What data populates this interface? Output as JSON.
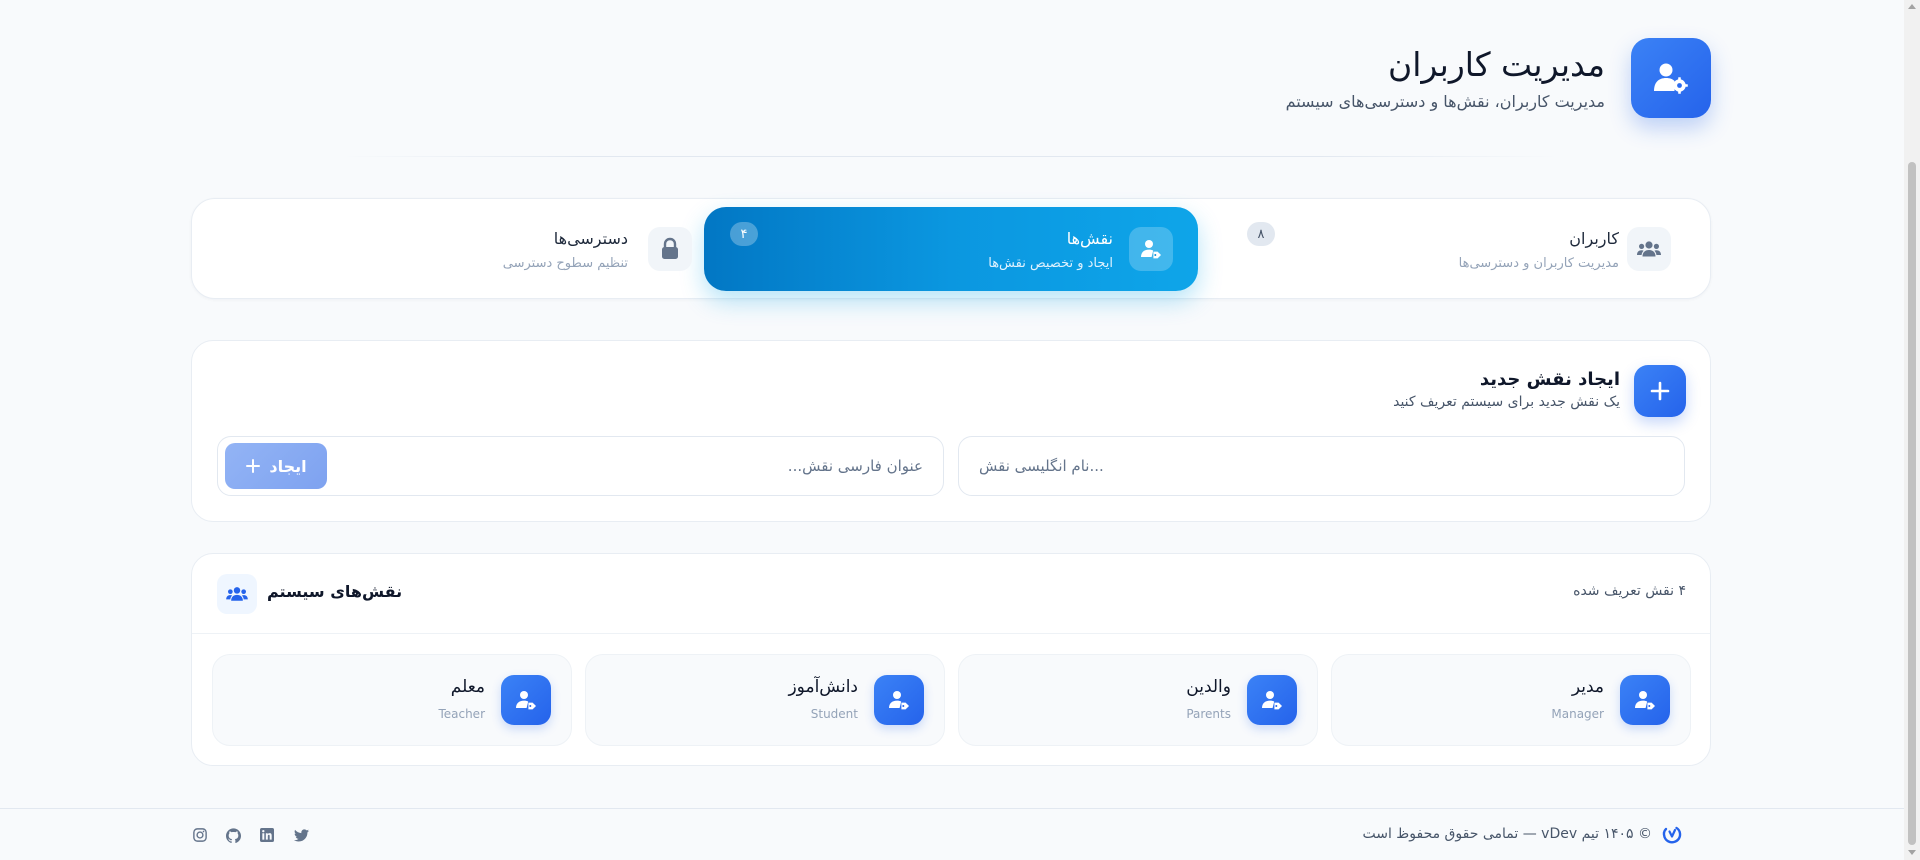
{
  "header": {
    "title": "مدیریت کاربران",
    "subtitle": "مدیریت کاربران، نقش‌ها و دسترسی‌های سیستم",
    "icon": "user-gear-icon"
  },
  "tabs": [
    {
      "key": "users",
      "label": "کاربران",
      "description": "مدیریت کاربران و دسترسی‌ها",
      "count": "۸",
      "icon": "users-icon",
      "active": false
    },
    {
      "key": "roles",
      "label": "نقش‌ها",
      "description": "ایجاد و تخصیص نقش‌ها",
      "count": "۴",
      "icon": "user-tag-icon",
      "active": true
    },
    {
      "key": "permissions",
      "label": "دسترسی‌ها",
      "description": "تنظیم سطوح دسترسی",
      "icon": "lock-icon",
      "active": false
    }
  ],
  "create_role": {
    "title": "ایجاد نقش جدید",
    "subtitle": "یک نقش جدید برای سیستم تعریف کنید",
    "english_name": {
      "value": "",
      "placeholder": "نام انگلیسی نقش..."
    },
    "persian_title": {
      "value": "",
      "placeholder": "عنوان فارسی نقش..."
    },
    "submit_label": "ایجاد"
  },
  "system_roles": {
    "title": "نقش‌های سیستم",
    "count_text": "۴ نقش تعریف شده",
    "items": [
      {
        "name": "مدیر",
        "english": "Manager"
      },
      {
        "name": "والدین",
        "english": "Parents"
      },
      {
        "name": "دانش‌آموز",
        "english": "Student"
      },
      {
        "name": "معلم",
        "english": "Teacher"
      }
    ]
  },
  "footer": {
    "copyright": "© ۱۴۰۵ تیم vDev — تمامی حقوق محفوظ است",
    "social": [
      "twitter-icon",
      "linkedin-icon",
      "github-icon",
      "instagram-icon"
    ]
  },
  "colors": {
    "primary": "#2563eb",
    "active_tab_start": "#0277c4",
    "active_tab_end": "#0ea5e9",
    "background": "#f8fafc"
  }
}
